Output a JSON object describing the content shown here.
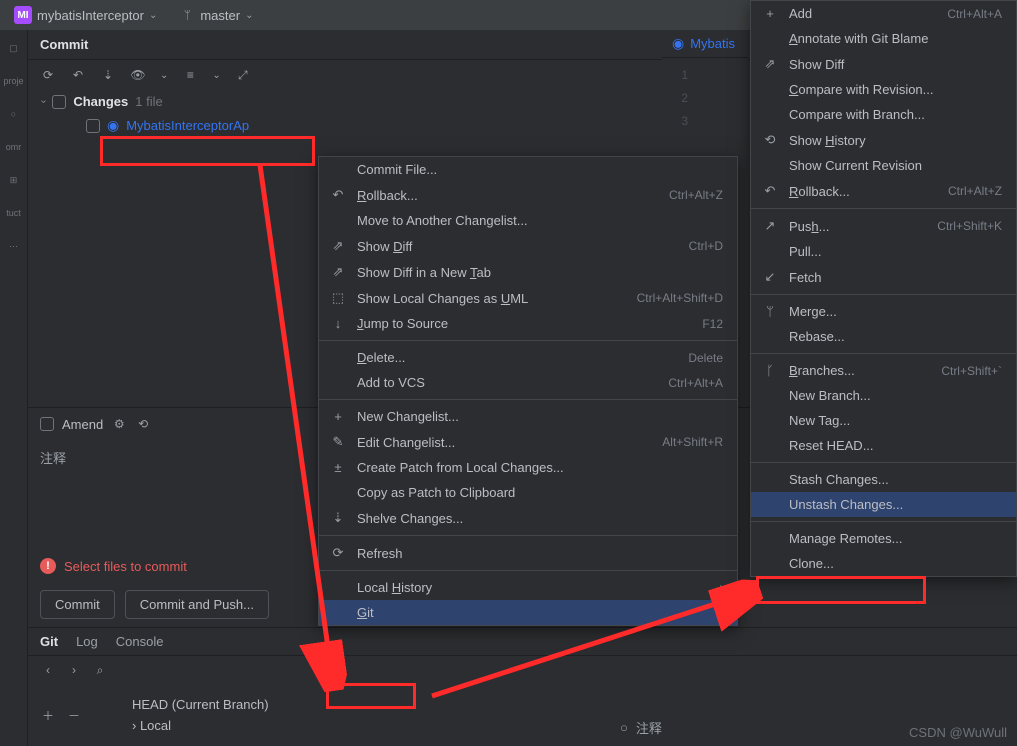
{
  "topbar": {
    "project": "mybatisInterceptor",
    "branch": "master",
    "badge": "MI"
  },
  "rail": [
    "proje",
    "omr",
    "tuct",
    "..."
  ],
  "panel": {
    "title": "Commit"
  },
  "changes": {
    "label": "Changes",
    "count": "1 file"
  },
  "file": {
    "name": "MybatisInterceptorAp"
  },
  "amend": {
    "label": "Amend"
  },
  "msg_placeholder": "注释",
  "warn": "Select files to commit",
  "buttons": {
    "commit": "Commit",
    "commit_push": "Commit and Push..."
  },
  "tabs": {
    "git": "Git",
    "log": "Log",
    "console": "Console"
  },
  "branches": {
    "head": "HEAD (Current Branch)",
    "local": "Local"
  },
  "editor": {
    "tab": "Mybatis",
    "lines": [
      "1",
      "2",
      "3"
    ]
  },
  "menu1": [
    {
      "type": "item",
      "icon": "",
      "label": "Commit File...",
      "sc": ""
    },
    {
      "type": "item",
      "icon": "↶",
      "label": "<u>R</u>ollback...",
      "sc": "Ctrl+Alt+Z"
    },
    {
      "type": "item",
      "icon": "",
      "label": "Move to Another Changelist...",
      "sc": ""
    },
    {
      "type": "item",
      "icon": "⇗",
      "label": "Show <u>D</u>iff",
      "sc": "Ctrl+D"
    },
    {
      "type": "item",
      "icon": "⇗",
      "label": "Show Diff in a New <u>T</u>ab",
      "sc": ""
    },
    {
      "type": "item",
      "icon": "⬚",
      "label": "Show Local Changes as <u>U</u>ML",
      "sc": "Ctrl+Alt+Shift+D"
    },
    {
      "type": "item",
      "icon": "↓",
      "label": "<u>J</u>ump to Source",
      "sc": "F12"
    },
    {
      "type": "sep"
    },
    {
      "type": "item",
      "icon": "",
      "label": "<u>D</u>elete...",
      "sc": "Delete"
    },
    {
      "type": "item",
      "icon": "",
      "label": "Add to VCS",
      "sc": "Ctrl+Alt+A"
    },
    {
      "type": "sep"
    },
    {
      "type": "item",
      "icon": "+",
      "label": "New Changelist...",
      "sc": ""
    },
    {
      "type": "item",
      "icon": "✎",
      "label": "Edit Changelist...",
      "sc": "Alt+Shift+R"
    },
    {
      "type": "item",
      "icon": "±",
      "label": "Create Patch from Local Changes...",
      "sc": ""
    },
    {
      "type": "item",
      "icon": "",
      "label": "Copy as Patch to Clipboard",
      "sc": ""
    },
    {
      "type": "item",
      "icon": "⇣",
      "label": "Shelve Changes...",
      "sc": ""
    },
    {
      "type": "sep"
    },
    {
      "type": "item",
      "icon": "⟳",
      "label": "Refresh",
      "sc": ""
    },
    {
      "type": "sep"
    },
    {
      "type": "sub",
      "icon": "",
      "label": "Local <u>H</u>istory",
      "sc": ""
    },
    {
      "type": "sub",
      "icon": "",
      "label": "<u>G</u>it",
      "sc": "",
      "sel": true
    }
  ],
  "menu2": [
    {
      "type": "item",
      "icon": "+",
      "label": "Add",
      "sc": "Ctrl+Alt+A"
    },
    {
      "type": "item",
      "icon": "",
      "label": "<u>A</u>nnotate with Git Blame",
      "sc": ""
    },
    {
      "type": "item",
      "icon": "⇗",
      "label": "Show Diff",
      "sc": ""
    },
    {
      "type": "item",
      "icon": "",
      "label": "<u>C</u>ompare with Revision...",
      "sc": ""
    },
    {
      "type": "item",
      "icon": "",
      "label": "Compare with Branch...",
      "sc": ""
    },
    {
      "type": "item",
      "icon": "⟲",
      "label": "Show <u>H</u>istory",
      "sc": ""
    },
    {
      "type": "item",
      "icon": "",
      "label": "Show Current Revision",
      "sc": ""
    },
    {
      "type": "item",
      "icon": "↶",
      "label": "<u>R</u>ollback...",
      "sc": "Ctrl+Alt+Z"
    },
    {
      "type": "sep"
    },
    {
      "type": "item",
      "icon": "↗",
      "label": "Pus<u>h</u>...",
      "sc": "Ctrl+Shift+K"
    },
    {
      "type": "item",
      "icon": "",
      "label": "Pull...",
      "sc": ""
    },
    {
      "type": "item",
      "icon": "↙",
      "label": "Fetch",
      "sc": ""
    },
    {
      "type": "sep"
    },
    {
      "type": "item",
      "icon": "ᛘ",
      "label": "Merge...",
      "sc": ""
    },
    {
      "type": "item",
      "icon": "",
      "label": "Rebase...",
      "sc": ""
    },
    {
      "type": "sep"
    },
    {
      "type": "item",
      "icon": "ᚴ",
      "label": "<u>B</u>ranches...",
      "sc": "Ctrl+Shift+`"
    },
    {
      "type": "item",
      "icon": "",
      "label": "New Branch...",
      "sc": ""
    },
    {
      "type": "item",
      "icon": "",
      "label": "New Tag...",
      "sc": ""
    },
    {
      "type": "item",
      "icon": "",
      "label": "Reset HEAD...",
      "sc": ""
    },
    {
      "type": "sep"
    },
    {
      "type": "item",
      "icon": "",
      "label": "Stash Changes...",
      "sc": ""
    },
    {
      "type": "item",
      "icon": "",
      "label": "Unstash Changes...",
      "sc": "",
      "sel": true
    },
    {
      "type": "sep"
    },
    {
      "type": "item",
      "icon": "",
      "label": "Manage Remotes...",
      "sc": ""
    },
    {
      "type": "item",
      "icon": "",
      "label": "Clone...",
      "sc": ""
    }
  ],
  "log_note": "注释",
  "watermark": "CSDN @WuWull"
}
